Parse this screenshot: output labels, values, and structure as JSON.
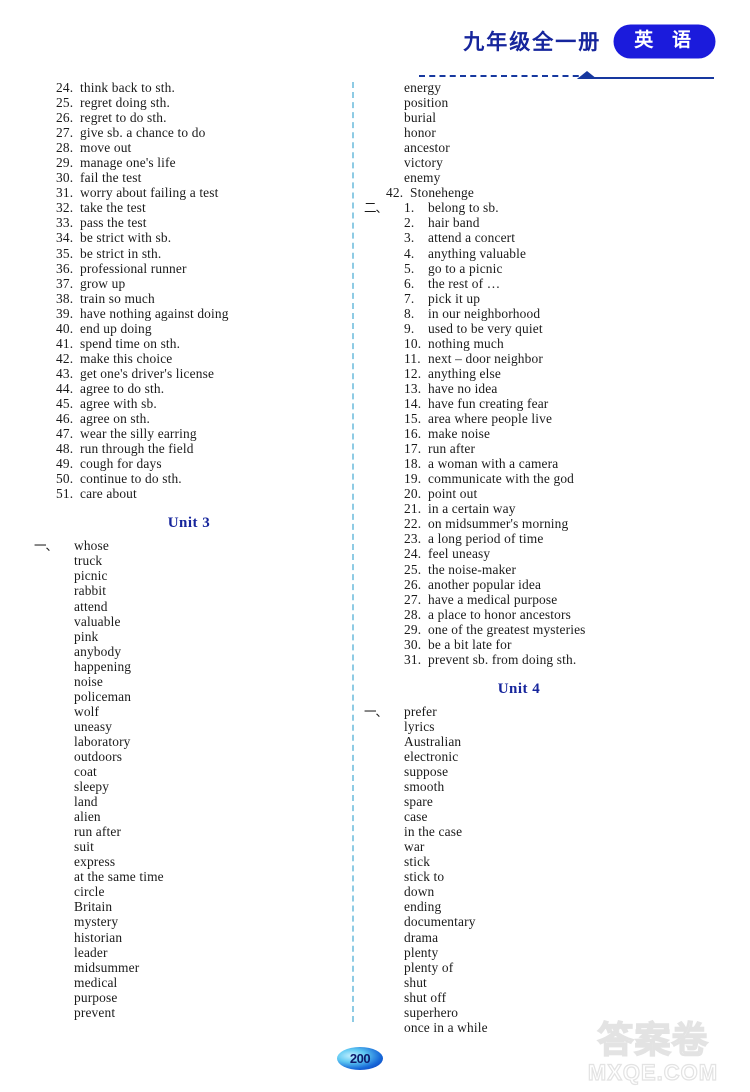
{
  "header": {
    "grade_title": "九年级全一册",
    "subject_badge": "英 语",
    "badge_color": "#1b1bdc",
    "heading_color": "#16259c"
  },
  "left_column": {
    "continued_numbered_list": {
      "items": [
        {
          "num": "24.",
          "text": "think back to sth."
        },
        {
          "num": "25.",
          "text": "regret doing sth."
        },
        {
          "num": "26.",
          "text": "regret to do sth."
        },
        {
          "num": "27.",
          "text": "give sb. a chance to do"
        },
        {
          "num": "28.",
          "text": "move out"
        },
        {
          "num": "29.",
          "text": "manage one's life"
        },
        {
          "num": "30.",
          "text": "fail the test"
        },
        {
          "num": "31.",
          "text": "worry about failing a test"
        },
        {
          "num": "32.",
          "text": "take the test"
        },
        {
          "num": "33.",
          "text": "pass the test"
        },
        {
          "num": "34.",
          "text": "be strict with sb."
        },
        {
          "num": "35.",
          "text": "be strict in sth."
        },
        {
          "num": "36.",
          "text": "professional runner"
        },
        {
          "num": "37.",
          "text": "grow up"
        },
        {
          "num": "38.",
          "text": "train so much"
        },
        {
          "num": "39.",
          "text": "have nothing against doing"
        },
        {
          "num": "40.",
          "text": "end up doing"
        },
        {
          "num": "41.",
          "text": "spend time on sth."
        },
        {
          "num": "42.",
          "text": "make this choice"
        },
        {
          "num": "43.",
          "text": "get one's driver's license"
        },
        {
          "num": "44.",
          "text": "agree to do sth."
        },
        {
          "num": "45.",
          "text": "agree with sb."
        },
        {
          "num": "46.",
          "text": "agree on sth."
        },
        {
          "num": "47.",
          "text": "wear the silly earring"
        },
        {
          "num": "48.",
          "text": "run through the field"
        },
        {
          "num": "49.",
          "text": "cough for days"
        },
        {
          "num": "50.",
          "text": "continue to do sth."
        },
        {
          "num": "51.",
          "text": "care about"
        }
      ]
    },
    "unit3_heading": "Unit 3",
    "unit3_section_marker": "一、",
    "unit3_words": [
      "whose",
      "truck",
      "picnic",
      "rabbit",
      "attend",
      "valuable",
      "pink",
      "anybody",
      "happening",
      "noise",
      "policeman",
      "wolf",
      "uneasy",
      "laboratory",
      "outdoors",
      "coat",
      "sleepy",
      "land",
      "alien",
      "run after",
      "suit",
      "express",
      "at the same time",
      "circle",
      "Britain",
      "mystery",
      "historian",
      "leader",
      "midsummer",
      "medical",
      "purpose",
      "prevent"
    ]
  },
  "right_column": {
    "unit3_words_continued": [
      "energy",
      "position",
      "burial",
      "honor",
      "ancestor",
      "victory",
      "enemy"
    ],
    "unit3_last_word_numbered": {
      "num": "42.",
      "text": "Stonehenge"
    },
    "unit3_section2_marker": "二、",
    "unit3_phrases": [
      {
        "num": "1.",
        "text": "belong to sb."
      },
      {
        "num": "2.",
        "text": "hair band"
      },
      {
        "num": "3.",
        "text": "attend a concert"
      },
      {
        "num": "4.",
        "text": "anything valuable"
      },
      {
        "num": "5.",
        "text": "go to a picnic"
      },
      {
        "num": "6.",
        "text": "the rest of …"
      },
      {
        "num": "7.",
        "text": "pick it up"
      },
      {
        "num": "8.",
        "text": "in our neighborhood"
      },
      {
        "num": "9.",
        "text": "used to be very quiet"
      },
      {
        "num": "10.",
        "text": "nothing much"
      },
      {
        "num": "11.",
        "text": "next – door neighbor"
      },
      {
        "num": "12.",
        "text": "anything else"
      },
      {
        "num": "13.",
        "text": "have no idea"
      },
      {
        "num": "14.",
        "text": "have fun creating fear"
      },
      {
        "num": "15.",
        "text": "area where people live"
      },
      {
        "num": "16.",
        "text": "make noise"
      },
      {
        "num": "17.",
        "text": "run after"
      },
      {
        "num": "18.",
        "text": "a woman with a camera"
      },
      {
        "num": "19.",
        "text": "communicate with the god"
      },
      {
        "num": "20.",
        "text": "point out"
      },
      {
        "num": "21.",
        "text": "in a certain way"
      },
      {
        "num": "22.",
        "text": "on midsummer's morning"
      },
      {
        "num": "23.",
        "text": "a long period of time"
      },
      {
        "num": "24.",
        "text": "feel uneasy"
      },
      {
        "num": "25.",
        "text": "the noise-maker"
      },
      {
        "num": "26.",
        "text": "another popular idea"
      },
      {
        "num": "27.",
        "text": "have a medical purpose"
      },
      {
        "num": "28.",
        "text": "a place to honor ancestors"
      },
      {
        "num": "29.",
        "text": "one of the greatest mysteries"
      },
      {
        "num": "30.",
        "text": "be a bit late for"
      },
      {
        "num": "31.",
        "text": "prevent sb. from doing sth."
      }
    ],
    "unit4_heading": "Unit 4",
    "unit4_section_marker": "一、",
    "unit4_words": [
      "prefer",
      "lyrics",
      "Australian",
      "electronic",
      "suppose",
      "smooth",
      "spare",
      "case",
      "in the case",
      "war",
      "stick",
      "stick to",
      "down",
      "ending",
      "documentary",
      "drama",
      "plenty",
      "plenty of",
      "shut",
      "shut off",
      "superhero",
      "once in a while"
    ]
  },
  "footer": {
    "page_number": "200",
    "watermark_cn": "答案卷",
    "watermark_en": "MXQE.COM"
  }
}
